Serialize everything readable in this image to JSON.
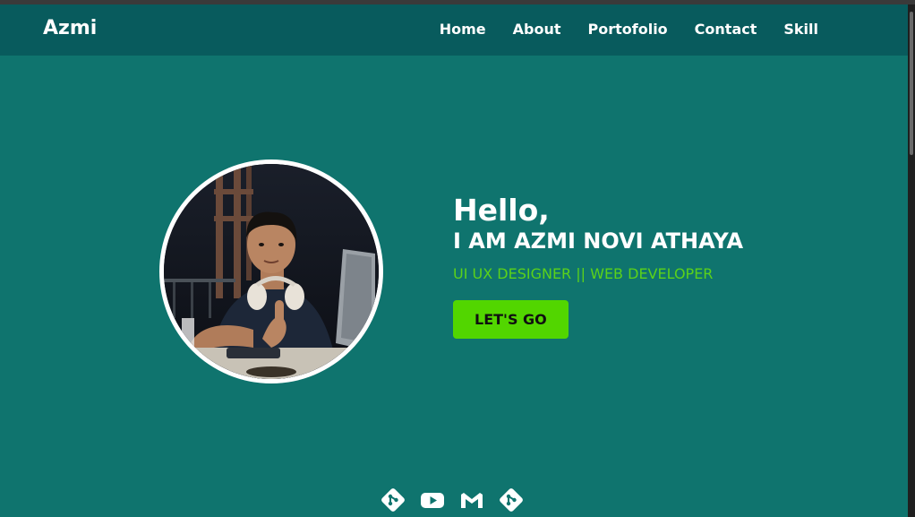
{
  "brand": "Azmi",
  "nav": {
    "items": [
      {
        "label": "Home"
      },
      {
        "label": "About"
      },
      {
        "label": "Portofolio"
      },
      {
        "label": "Contact"
      },
      {
        "label": "Skill"
      }
    ]
  },
  "hero": {
    "greeting": "Hello,",
    "name": "I AM AZMI NOVI ATHAYA",
    "role": "UI UX DESIGNER || WEB DEVELOPER",
    "cta_label": "LET'S GO"
  },
  "socials": [
    {
      "icon": "git-icon"
    },
    {
      "icon": "youtube-icon"
    },
    {
      "icon": "gmail-icon"
    },
    {
      "icon": "git-icon"
    }
  ],
  "colors": {
    "page_bg": "#0f746e",
    "navbar_bg": "#085b5d",
    "accent_green": "#52d600",
    "role_text": "#5bd21a"
  }
}
